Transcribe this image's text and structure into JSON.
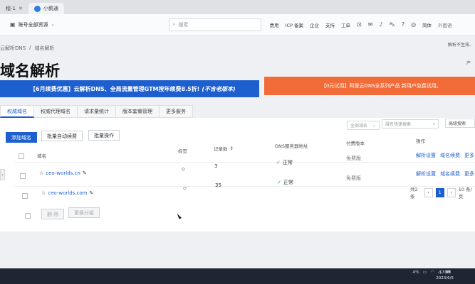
{
  "browser": {
    "tabs": [
      {
        "label": "程-1",
        "active": false
      },
      {
        "label": "小鹅通",
        "active": true
      }
    ]
  },
  "topnav": {
    "account_label": "账号全部资源",
    "search_placeholder": "搜索",
    "links": [
      "费用",
      "ICP 备案",
      "企业",
      "支持",
      "工单"
    ],
    "user_label": "简体",
    "side_text": "外国语"
  },
  "breadcrumb": [
    "云解析DNS",
    "域名解析"
  ],
  "topright": {
    "link1": "解析不生效、",
    "link2": "产"
  },
  "page_title": "域名解析",
  "banners": {
    "blue": "【6月续费优惠】云解析DNS、全局流量管理GTM按年续费8.5折!",
    "blue_italic": "(不含老版本)",
    "orange": "【0元试用】阿里云DNS全系列产品 新用户免费试用。"
  },
  "tabs": [
    "权威域名",
    "权威代理域名",
    "请求量统计",
    "版本套餐管理",
    "更多服务"
  ],
  "actions": {
    "add": "添加域名",
    "batch_renew": "批量自动续费",
    "batch_ops": "批量操作",
    "filter_select": "全部域名",
    "filter_input": "域名快速搜索",
    "advanced": "高级搜索"
  },
  "table": {
    "headers": {
      "name": "域名",
      "tag": "标签",
      "records": "记录数",
      "dns": "DNS服务器地址",
      "plan": "付费版本",
      "ops": "操作"
    },
    "rows": [
      {
        "domain": "ceo-worlds.cn",
        "records": "3",
        "dns": "正常",
        "plan": "免费版",
        "op1": "解析设置",
        "op2": "域名续费",
        "more": "更多"
      },
      {
        "domain": "ceo-worlds.com",
        "records": "35",
        "dns": "正常",
        "plan": "免费版",
        "op1": "解析设置",
        "op2": "域名续费",
        "more": "更多"
      }
    ]
  },
  "footer": {
    "delete": "删 除",
    "change_group": "更换分组"
  },
  "pager": {
    "total": "共2条",
    "current": "1",
    "per_page": "10 条/页"
  },
  "taskbar": {
    "battery": "4%",
    "time": "17:05",
    "date": "2023/6/5"
  }
}
